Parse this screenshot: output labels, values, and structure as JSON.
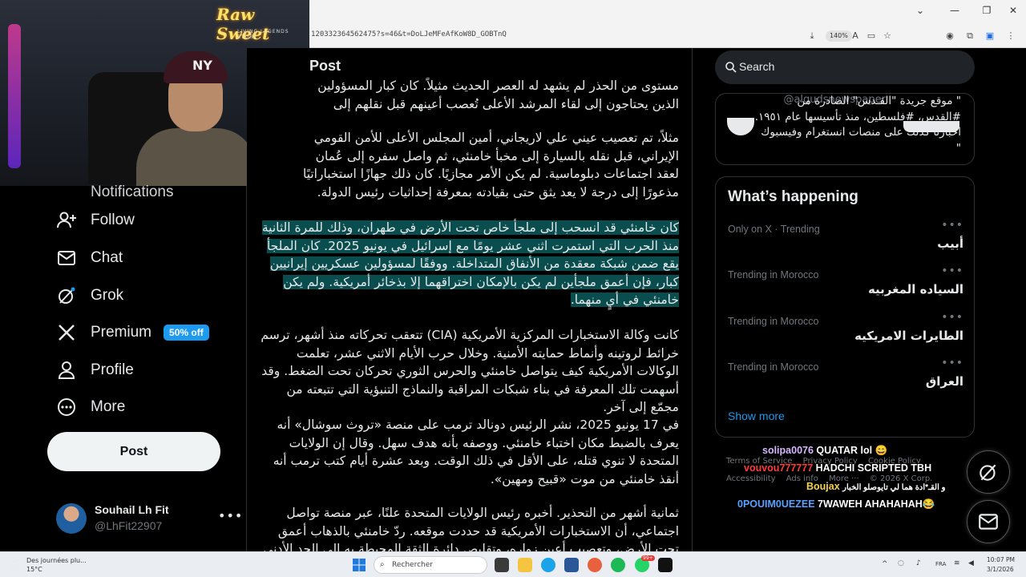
{
  "browser": {
    "url": "120332364562475?s=46&t=DoLJeMFeAfKoW8D_GOBTnQ",
    "zoom": "140%"
  },
  "stream": {
    "logo_text": "Raw Sweet",
    "logo_sub": "LIVING LEGENDS STORE"
  },
  "nav": {
    "partial_item": "Notifications",
    "items": [
      {
        "label": "Follow",
        "icon": "follow-icon"
      },
      {
        "label": "Chat",
        "icon": "mail-icon"
      },
      {
        "label": "Grok",
        "icon": "grok-icon"
      },
      {
        "label": "Premium",
        "icon": "x-logo-icon"
      },
      {
        "label": "Profile",
        "icon": "person-icon"
      },
      {
        "label": "More",
        "icon": "more-circle-icon"
      }
    ],
    "premium_badge": "50% off",
    "post_button": "Post",
    "account": {
      "name": "Souhail Lh Fit",
      "handle": "@LhFit22907"
    }
  },
  "main": {
    "title": "Post",
    "paragraphs": [
      "مستوى من الحذر لم يشهد له العصر الحديث مثيلاً. كان كبار المسؤولين الذين يحتاجون إلى لقاء المرشد الأعلى تُعصب أعينهم قبل نقلهم إلى موقعه.",
      "مثلاً، تم تعصيب عيني علي لاريجاني، أمين المجلس الأعلى للأمن القومي الإيراني، قبل نقله بالسيارة إلى مخبأ خامنئي، ثم واصل سفره إلى عُمان لعقد اجتماعات دبلوماسية. لم يكن الأمر مجازيًا. كان ذلك جهازًا استخباراتيًا مذعورًا إلى درجة لا يعد يثق حتى بقيادته بمعرفة إحداثيات رئيس الدولة.",
      "كان خامنئي قد انسحب إلى ملجأ خاص تحت الأرض في طهران، وذلك للمرة الثانية منذ الحرب التي استمرت اثني عشر يومًا مع إسرائيل في يونيو 2025. كان الملجأ يقع ضمن شبكة معقدة من الأنفاق المتداخلة. ووفقًا لمسؤولين عسكريين إيرانيين كبار، فإن أعمق ملجأين لم يكن بالإمكان اختراقهما إلا بذخائر أمريكية. ولم يكن خامنئي في أيٍ منهما.",
      "كانت وكالة الاستخبارات المركزية الأمريكية (CIA) تتعقب تحركاته منذ أشهر، ترسم خرائط لروتينه وأنماط حمايته الأمنية. وخلال حرب الأيام الاثني عشر، تعلمت الوكالات الأمريكية كيف يتواصل خامنئي والحرس الثوري تحركان تحت الضغط. وقد أسهمت تلك المعرفة في بناء شبكات المراقبة والنماذج التنبؤية التي تتبعته من مجمّع إلى آخر.",
      "في 17 يونيو 2025، نشر الرئيس دونالد ترمب على منصة «تروث سوشال» أنه يعرف بالضبط مكان اختباء خامنئي. ووصفه بأنه هدف سهل. وقال إن الولايات المتحدة لا تنوي قتله، على الأقل في ذلك الوقت. وبعد عشرة أيام كتب ترمب أنه أنقذ خامنئي من موت «قبيح ومهين».",
      "ثمانية أشهر من التحذير. أخبره رئيس الولايات المتحدة علنًا، عبر منصة تواصل اجتماعي، أن الاستخبارات الأمريكية قد حددت موقعه. ردّ خامنئي بالذهاب أعمق تحت الأرض، وتعصيب أعين زواره، وتقليص دائرة الثقة المحيطة به إلى الحد الأدنى."
    ]
  },
  "sidebar": {
    "search_placeholder": "Search",
    "embedded_tweet": {
      "handle": "@alqudsnewspaper",
      "text": "\" موقع جريدة \"القـدس\" الصادرة من #القدس، #فلسطين، منذ تأسيسها عام ١٩٥١. اخبارنا كذلك على منصات انستغرام وفيسبوك \""
    },
    "whats_happening": {
      "title": "What’s happening",
      "trends": [
        {
          "context": "Only on X · Trending",
          "name": "أبيب"
        },
        {
          "context": "Trending in Morocco",
          "name": "السياده المغربيه"
        },
        {
          "context": "Trending in Morocco",
          "name": "الطايرات الامريكيه"
        },
        {
          "context": "Trending in Morocco",
          "name": "العراق"
        }
      ],
      "show_more": "Show more"
    },
    "footer_links": [
      "Terms of Service",
      "Privacy Policy",
      "Cookie Policy",
      "Accessibility",
      "Ads info",
      "More ···",
      "© 2026 X Corp."
    ]
  },
  "chat_overlay": [
    {
      "user": "solipa0076",
      "message": "QUATAR lol 😄",
      "color": "#d7b6ff"
    },
    {
      "user": "vouvou777777",
      "message": "HADCHI SCRIPTED TBH",
      "color": "#ff3b3b"
    },
    {
      "user": "Boujax",
      "message": "و القـ*ادة هما لي تايوصلو الخبار",
      "color": "#f6d14a"
    },
    {
      "user": "0POUIM0UEZEE",
      "message": "7WAWEH AHAHAHAH😂",
      "color": "#5aa0ff"
    }
  ],
  "taskbar": {
    "weather_desc": "Des journées plu...",
    "weather_temp": "15°C",
    "search_label": "Rechercher",
    "whatsapp_badge": "99+",
    "language": "FRA",
    "time": "10:07 PM",
    "date": "3/1/2026"
  },
  "colors": {
    "accent": "#1d9bf0",
    "highlight": "#0a4d4f",
    "background": "#000000",
    "border": "#2f3336"
  }
}
